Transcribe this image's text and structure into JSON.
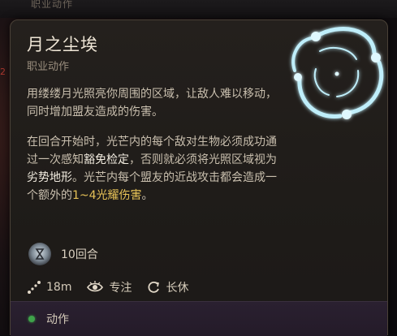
{
  "background": {
    "top_label": "职业动作",
    "side_mark": "2"
  },
  "tooltip": {
    "title": "月之尘埃",
    "subtitle": "职业动作",
    "description_1": "用缕缕月光照亮你周围的区域，让敌人难以移动，同时增加盟友造成的伤害。",
    "description_2": {
      "part1": "在回合开始时，光芒内的每个敌对生物必须成功通过一次感知",
      "save": "豁免检定",
      "part2": "，否则就必须将光照区域视为",
      "terrain": "劣势地形",
      "part3": "。光芒内每个盟友的近战攻击都会造成一个额外的",
      "damage": "1~4光耀伤害",
      "part4": "。"
    },
    "duration": "10回合",
    "range": "18m",
    "concentration": "专注",
    "rest": "长休",
    "action_type": "动作"
  },
  "colors": {
    "gold_highlight": "#e7c257",
    "action_dot": "#3fa34a",
    "spell_glow": "#9fe3f2"
  },
  "icons": {
    "spell": "moonbeam-swirl-icon",
    "duration": "hourglass-orb-icon",
    "range": "range-line-icon",
    "concentration": "eye-icon",
    "rest": "rest-cycle-icon",
    "action": "action-dot-icon"
  }
}
